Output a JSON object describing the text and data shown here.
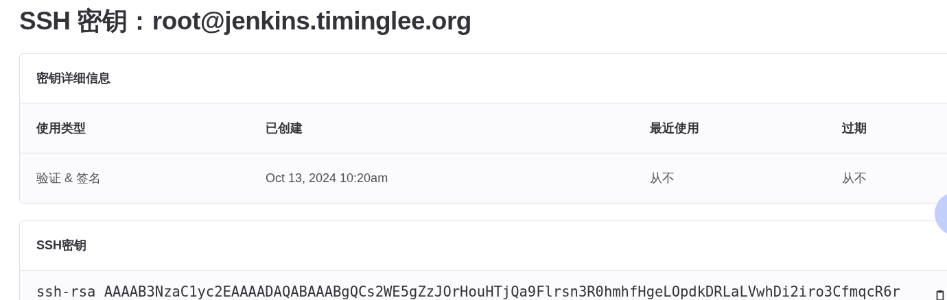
{
  "title": "SSH 密钥：root@jenkins.timinglee.org",
  "details": {
    "heading": "密钥详细信息",
    "columns": [
      "使用类型",
      "已创建",
      "最近使用",
      "过期"
    ],
    "rows": [
      [
        "验证 & 签名",
        "Oct 13, 2024 10:20am",
        "从不",
        "从不"
      ]
    ]
  },
  "key": {
    "heading": "SSH密钥",
    "value": "ssh-rsa AAAAB3NzaC1yc2EAAAADAQABAAABgQCs2WE5gZzJOrHouHTjQa9Flrsn3R0hmhfHgeLOpdkDRLaLVwhDi2iro3CfmqcR6r"
  }
}
